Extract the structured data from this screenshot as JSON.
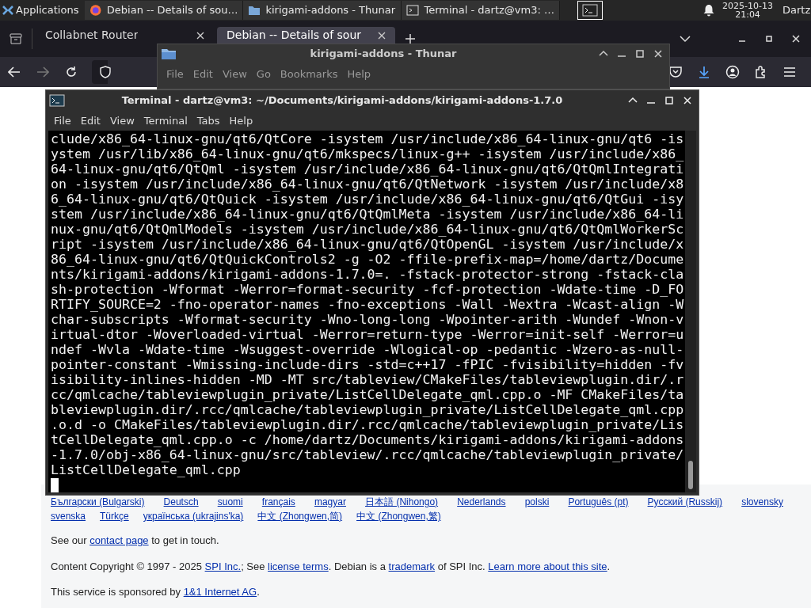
{
  "panel": {
    "apps_menu": "Applications",
    "tasks": [
      {
        "kind": "browser",
        "title": "Debian -- Details of sou…"
      },
      {
        "kind": "folder",
        "title": "kirigami-addons - Thunar"
      },
      {
        "kind": "terminal",
        "title": "Terminal - dartz@vm3: …"
      }
    ],
    "clock": {
      "date": "2025-10-13",
      "time": "21:04"
    },
    "user": "Dartz"
  },
  "browser": {
    "tabs": [
      {
        "title": "Collabnet Router",
        "selected": false
      },
      {
        "title": "Debian -- Details of sour",
        "selected": true
      }
    ],
    "forward_disabled": true,
    "page": {
      "languages_row_1": [
        "Български (Bulgarski)",
        "Deutsch",
        "suomi",
        "français",
        "magyar",
        "日本語 (Nihongo)",
        "Nederlands",
        "polski",
        "Português (pt)",
        "Русский (Russkij)",
        "slovensky"
      ],
      "languages_row_2": [
        "svenska",
        "Türkçe",
        "українська (ukrajins'ka)",
        "中文 (Zhongwen,简)",
        "中文 (Zhongwen,繁)"
      ],
      "paragraphs": [
        [
          {
            "text": "See our "
          },
          {
            "text": "contact page",
            "link": true
          },
          {
            "text": " to get in touch."
          }
        ],
        [
          {
            "text": "Content Copyright © 1997 - 2025 "
          },
          {
            "text": "SPI Inc.",
            "link": true
          },
          {
            "text": "; See "
          },
          {
            "text": "license terms",
            "link": true
          },
          {
            "text": ". Debian is a "
          },
          {
            "text": "trademark",
            "link": true
          },
          {
            "text": " of SPI Inc. "
          },
          {
            "text": "Learn more about this site",
            "link": true
          },
          {
            "text": "."
          }
        ],
        [
          {
            "text": "This service is sponsored by "
          },
          {
            "text": "1&1 Internet AG",
            "link": true
          },
          {
            "text": "."
          }
        ]
      ]
    }
  },
  "file_manager": {
    "title": "kirigami-addons - Thunar",
    "menu": [
      "File",
      "Edit",
      "View",
      "Go",
      "Bookmarks",
      "Help"
    ]
  },
  "terminal": {
    "title": "Terminal - dartz@vm3: ~/Documents/kirigami-addons/kirigami-addons-1.7.0",
    "menu": [
      "File",
      "Edit",
      "View",
      "Terminal",
      "Tabs",
      "Help"
    ],
    "lines": [
      "clude/x86_64-linux-gnu/qt6/QtCore -isystem /usr/include/x86_64-linux-gnu/qt6 -is",
      "ystem /usr/lib/x86_64-linux-gnu/qt6/mkspecs/linux-g++ -isystem /usr/include/x86_",
      "64-linux-gnu/qt6/QtQml -isystem /usr/include/x86_64-linux-gnu/qt6/QtQmlIntegrati",
      "on -isystem /usr/include/x86_64-linux-gnu/qt6/QtNetwork -isystem /usr/include/x8",
      "6_64-linux-gnu/qt6/QtQuick -isystem /usr/include/x86_64-linux-gnu/qt6/QtGui -isy",
      "stem /usr/include/x86_64-linux-gnu/qt6/QtQmlMeta -isystem /usr/include/x86_64-li",
      "nux-gnu/qt6/QtQmlModels -isystem /usr/include/x86_64-linux-gnu/qt6/QtQmlWorkerSc",
      "ript -isystem /usr/include/x86_64-linux-gnu/qt6/QtOpenGL -isystem /usr/include/x",
      "86_64-linux-gnu/qt6/QtQuickControls2 -g -O2 -ffile-prefix-map=/home/dartz/Docume",
      "nts/kirigami-addons/kirigami-addons-1.7.0=. -fstack-protector-strong -fstack-cla",
      "sh-protection -Wformat -Werror=format-security -fcf-protection -Wdate-time -D_FO",
      "RTIFY_SOURCE=2 -fno-operator-names -fno-exceptions -Wall -Wextra -Wcast-align -W",
      "char-subscripts -Wformat-security -Wno-long-long -Wpointer-arith -Wundef -Wnon-v",
      "irtual-dtor -Woverloaded-virtual -Werror=return-type -Werror=init-self -Werror=u",
      "ndef -Wvla -Wdate-time -Wsuggest-override -Wlogical-op -pedantic -Wzero-as-null-",
      "pointer-constant -Wmissing-include-dirs -std=c++17 -fPIC -fvisibility=hidden -fv",
      "isibility-inlines-hidden -MD -MT src/tableview/CMakeFiles/tableviewplugin.dir/.r",
      "cc/qmlcache/tableviewplugin_private/ListCellDelegate_qml.cpp.o -MF CMakeFiles/ta",
      "bleviewplugin.dir/.rcc/qmlcache/tableviewplugin_private/ListCellDelegate_qml.cpp",
      ".o.d -o CMakeFiles/tableviewplugin.dir/.rcc/qmlcache/tableviewplugin_private/Lis",
      "tCellDelegate_qml.cpp.o -c /home/dartz/Documents/kirigami-addons/kirigami-addons",
      "-1.7.0/obj-x86_64-linux-gnu/src/tableview/.rcc/qmlcache/tableviewplugin_private/",
      "ListCellDelegate_qml.cpp"
    ]
  }
}
